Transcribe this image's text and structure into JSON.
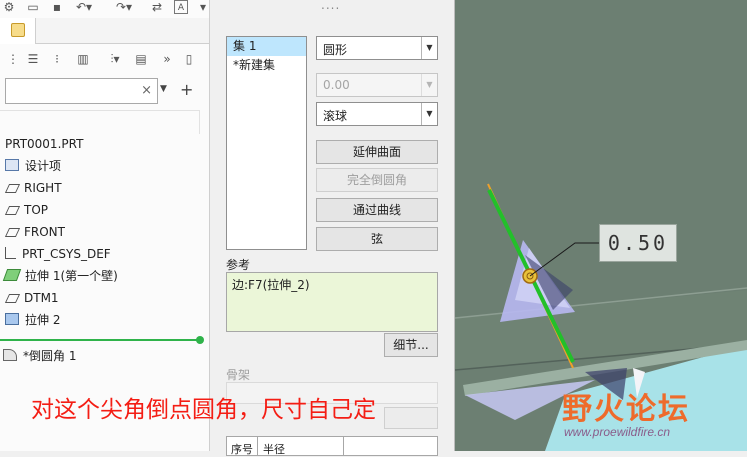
{
  "model_tree": {
    "search": {
      "value": "",
      "clear_glyph": "×"
    },
    "items": [
      {
        "label": "PRT0001.PRT",
        "icon": ""
      },
      {
        "label": "设计项",
        "icon": "design-items-icon"
      },
      {
        "label": "RIGHT",
        "icon": "datum-plane-icon"
      },
      {
        "label": "TOP",
        "icon": "datum-plane-icon"
      },
      {
        "label": "FRONT",
        "icon": "datum-plane-icon"
      },
      {
        "label": "PRT_CSYS_DEF",
        "icon": "csys-icon"
      },
      {
        "label": "拉伸 1(第一个壁)",
        "icon": "sheetmetal-wall-icon"
      },
      {
        "label": "DTM1",
        "icon": "datum-plane-icon"
      },
      {
        "label": "拉伸 2",
        "icon": "extrude-icon"
      },
      {
        "label": "*倒圆角 1",
        "icon": "round-icon"
      }
    ]
  },
  "round_dialog": {
    "sets": [
      "集 1",
      "*新建集"
    ],
    "shape_combo": "圆形",
    "value_combo": "0.00",
    "method_combo": "滚球",
    "buttons": [
      "延伸曲面",
      "完全倒圆角",
      "通过曲线",
      "弦"
    ],
    "references_label": "参考",
    "reference_value": "边:F7(拉伸_2)",
    "details_button": "细节...",
    "skeleton_label": "骨架",
    "table_headers": [
      "序号",
      "半径"
    ]
  },
  "viewport": {
    "dimension_value": "0.50"
  },
  "overlay": {
    "caption": "对这个尖角倒点圆角，尺寸自己定",
    "watermark_title": "野火论坛",
    "watermark_url": "www.proewildfire.cn"
  },
  "colors": {
    "caption": "#f41d14",
    "watermark": "#ee6b2b",
    "viewport_bg": "#6c7f72",
    "edge_highlight": "#22c02a",
    "reference_box": "#ebf6d8",
    "selected_set": "#bee6fd"
  }
}
